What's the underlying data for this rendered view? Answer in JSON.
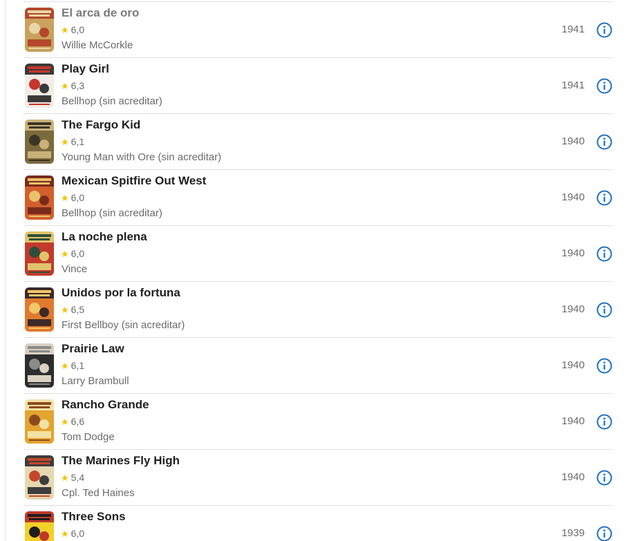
{
  "colors": {
    "star": "#f2c300",
    "info_icon": "#1f6fc5",
    "divider": "#e0e0e0",
    "secondary_text": "#6b6b6b"
  },
  "films": [
    {
      "title": "El arca de oro",
      "rating": "6,0",
      "role": "Willie McCorkle",
      "year": "1941",
      "poster_colors": [
        "#c9a25e",
        "#e8d6a4",
        "#b4472c"
      ]
    },
    {
      "title": "Play Girl",
      "rating": "6,3",
      "role": "Bellhop (sin acreditar)",
      "year": "1941",
      "poster_colors": [
        "#f1ede6",
        "#c8342b",
        "#3a3a3a"
      ]
    },
    {
      "title": "The Fargo Kid",
      "rating": "6,1",
      "role": "Young Man with Ore (sin acreditar)",
      "year": "1940",
      "poster_colors": [
        "#7c6a3f",
        "#3b3526",
        "#c9b27a"
      ]
    },
    {
      "title": "Mexican Spitfire Out West",
      "rating": "6,0",
      "role": "Bellhop (sin acreditar)",
      "year": "1940",
      "poster_colors": [
        "#d2602e",
        "#e9c36b",
        "#7a2a1c"
      ]
    },
    {
      "title": "La noche plena",
      "rating": "6,0",
      "role": "Vince",
      "year": "1940",
      "poster_colors": [
        "#c23a2c",
        "#2e4f3a",
        "#e0c46c"
      ]
    },
    {
      "title": "Unidos por la fortuna",
      "rating": "6,5",
      "role": "First Bellboy (sin acreditar)",
      "year": "1940",
      "poster_colors": [
        "#e07a2f",
        "#f2c768",
        "#3b2a2a"
      ]
    },
    {
      "title": "Prairie Law",
      "rating": "6,1",
      "role": "Larry Brambull",
      "year": "1940",
      "poster_colors": [
        "#2d2d2d",
        "#8a8a8a",
        "#d9d1c2"
      ]
    },
    {
      "title": "Rancho Grande",
      "rating": "6,6",
      "role": "Tom Dodge",
      "year": "1940",
      "poster_colors": [
        "#e3a431",
        "#8c4a1f",
        "#f3e1a5"
      ]
    },
    {
      "title": "The Marines Fly High",
      "rating": "5,4",
      "role": "Cpl. Ted Haines",
      "year": "1940",
      "poster_colors": [
        "#e6d7b0",
        "#c6452b",
        "#3d3d3d"
      ]
    },
    {
      "title": "Three Sons",
      "rating": "6,0",
      "role": "",
      "year": "1939",
      "poster_colors": [
        "#f2d02a",
        "#1d1d1d",
        "#c0392b"
      ]
    }
  ]
}
